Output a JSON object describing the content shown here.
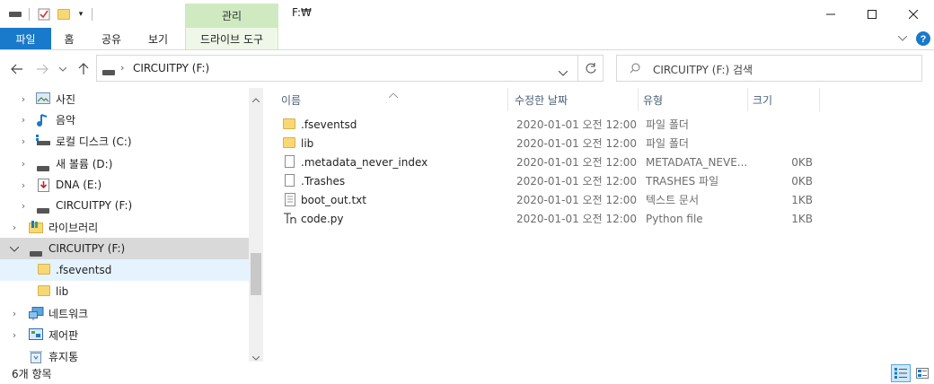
{
  "window": {
    "title": "F:₩",
    "context_tab": "관리"
  },
  "ribbon": {
    "tabs": [
      "파일",
      "홈",
      "공유",
      "보기"
    ],
    "drive_tools": "드라이브 도구"
  },
  "address": {
    "path": "CIRCUITPY (F:)",
    "search_placeholder": "CIRCUITPY (F:) 검색"
  },
  "nav": {
    "items": [
      {
        "label": "사진",
        "icon": "pictures-icon"
      },
      {
        "label": "음악",
        "icon": "music-icon"
      },
      {
        "label": "로컬 디스크 (C:)",
        "icon": "local-disk-icon"
      },
      {
        "label": "새 볼륨 (D:)",
        "icon": "drive-icon"
      },
      {
        "label": "DNA (E:)",
        "icon": "dna-drive-icon"
      },
      {
        "label": "CIRCUITPY (F:)",
        "icon": "drive-icon"
      },
      {
        "label": "라이브러리",
        "icon": "library-icon"
      },
      {
        "label": "CIRCUITPY (F:)",
        "icon": "drive-icon"
      },
      {
        "label": ".fseventsd",
        "icon": "folder-icon"
      },
      {
        "label": "lib",
        "icon": "folder-icon"
      },
      {
        "label": "네트워크",
        "icon": "network-icon"
      },
      {
        "label": "제어판",
        "icon": "control-panel-icon"
      },
      {
        "label": "휴지통",
        "icon": "recycle-bin-icon"
      }
    ]
  },
  "columns": {
    "name": "이름",
    "date": "수정한 날짜",
    "type": "유형",
    "size": "크기"
  },
  "files": [
    {
      "name": ".fseventsd",
      "date": "2020-01-01 오전 12:00",
      "type": "파일 폴더",
      "size": "",
      "icon": "folder-icon"
    },
    {
      "name": "lib",
      "date": "2020-01-01 오전 12:00",
      "type": "파일 폴더",
      "size": "",
      "icon": "folder-icon"
    },
    {
      "name": ".metadata_never_index",
      "date": "2020-01-01 오전 12:00",
      "type": "METADATA_NEVE...",
      "size": "0KB",
      "icon": "file-icon"
    },
    {
      "name": ".Trashes",
      "date": "2020-01-01 오전 12:00",
      "type": "TRASHES 파일",
      "size": "0KB",
      "icon": "file-icon"
    },
    {
      "name": "boot_out.txt",
      "date": "2020-01-01 오전 12:00",
      "type": "텍스트 문서",
      "size": "1KB",
      "icon": "text-file-icon"
    },
    {
      "name": "code.py",
      "date": "2020-01-01 오전 12:00",
      "type": "Python file",
      "size": "1KB",
      "icon": "python-file-icon"
    }
  ],
  "status": {
    "count": "6개 항목"
  }
}
